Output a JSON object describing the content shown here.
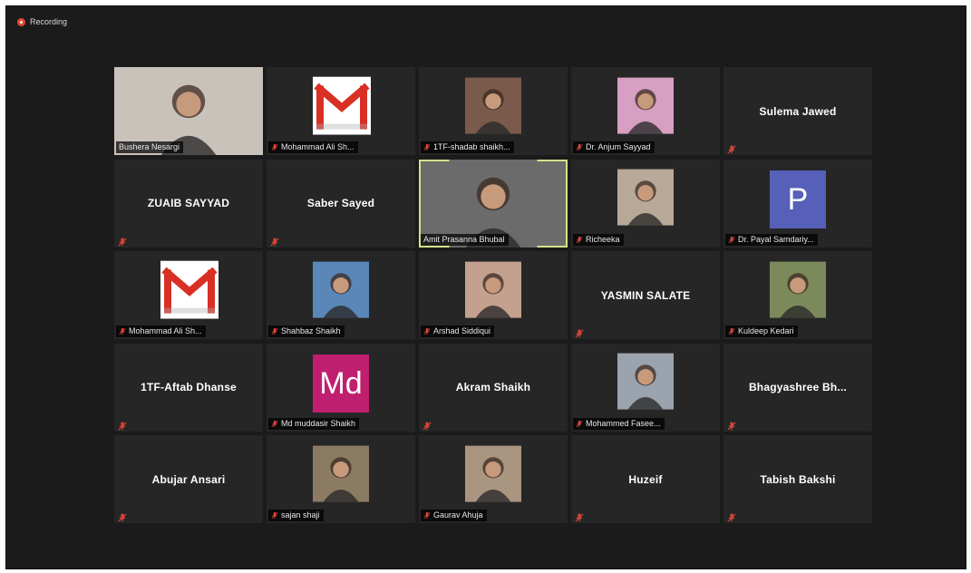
{
  "recording": {
    "label": "Recording"
  },
  "participants": [
    {
      "name": "Bushera Nesargi",
      "type": "video",
      "color": "#c9c2bb"
    },
    {
      "name": "Mohammad Ali Sh...",
      "type": "gmail"
    },
    {
      "name": "1TF-shadab shaikh...",
      "type": "photo",
      "color": "#7a5a4a"
    },
    {
      "name": "Dr. Anjum Sayyad",
      "type": "photo",
      "color": "#d79fc1"
    },
    {
      "name": "Sulema Jawed",
      "type": "name"
    },
    {
      "name": "ZUAIB SAYYAD",
      "type": "name"
    },
    {
      "name": "Saber Sayed",
      "type": "name"
    },
    {
      "name": "Amit Prasanna Bhubal",
      "type": "video-active",
      "color": "#6b6b6b"
    },
    {
      "name": "Richeeka",
      "type": "photo",
      "color": "#b8a898"
    },
    {
      "name": "Dr. Payal Samdariy...",
      "type": "letter",
      "letter": "P",
      "color": "#5660b8"
    },
    {
      "name": "Mohammad Ali Sh...",
      "type": "gmail"
    },
    {
      "name": "Shahbaz Shaikh",
      "type": "photo",
      "color": "#5a87b8"
    },
    {
      "name": "Arshad Siddiqui",
      "type": "photo",
      "color": "#c4a08f"
    },
    {
      "name": "YASMIN SALATE",
      "type": "name"
    },
    {
      "name": "Kuldeep Kedari",
      "type": "photo",
      "color": "#7c8a5b"
    },
    {
      "name": "1TF-Aftab Dhanse",
      "type": "name"
    },
    {
      "name": "Md muddasir Shaikh",
      "type": "letter",
      "letter": "Md",
      "color": "#c01f6f"
    },
    {
      "name": "Akram Shaikh",
      "type": "name"
    },
    {
      "name": "Mohammed Fasee...",
      "type": "photo",
      "color": "#9aa3ae"
    },
    {
      "name": "Bhagyashree Bh...",
      "type": "name"
    },
    {
      "name": "Abujar Ansari",
      "type": "name"
    },
    {
      "name": "sajan shaji",
      "type": "photo",
      "color": "#8c7b63"
    },
    {
      "name": "Gaurav Ahuja",
      "type": "photo",
      "color": "#a99580"
    },
    {
      "name": "Huzeif",
      "type": "name"
    },
    {
      "name": "Tabish Bakshi",
      "type": "name"
    }
  ]
}
